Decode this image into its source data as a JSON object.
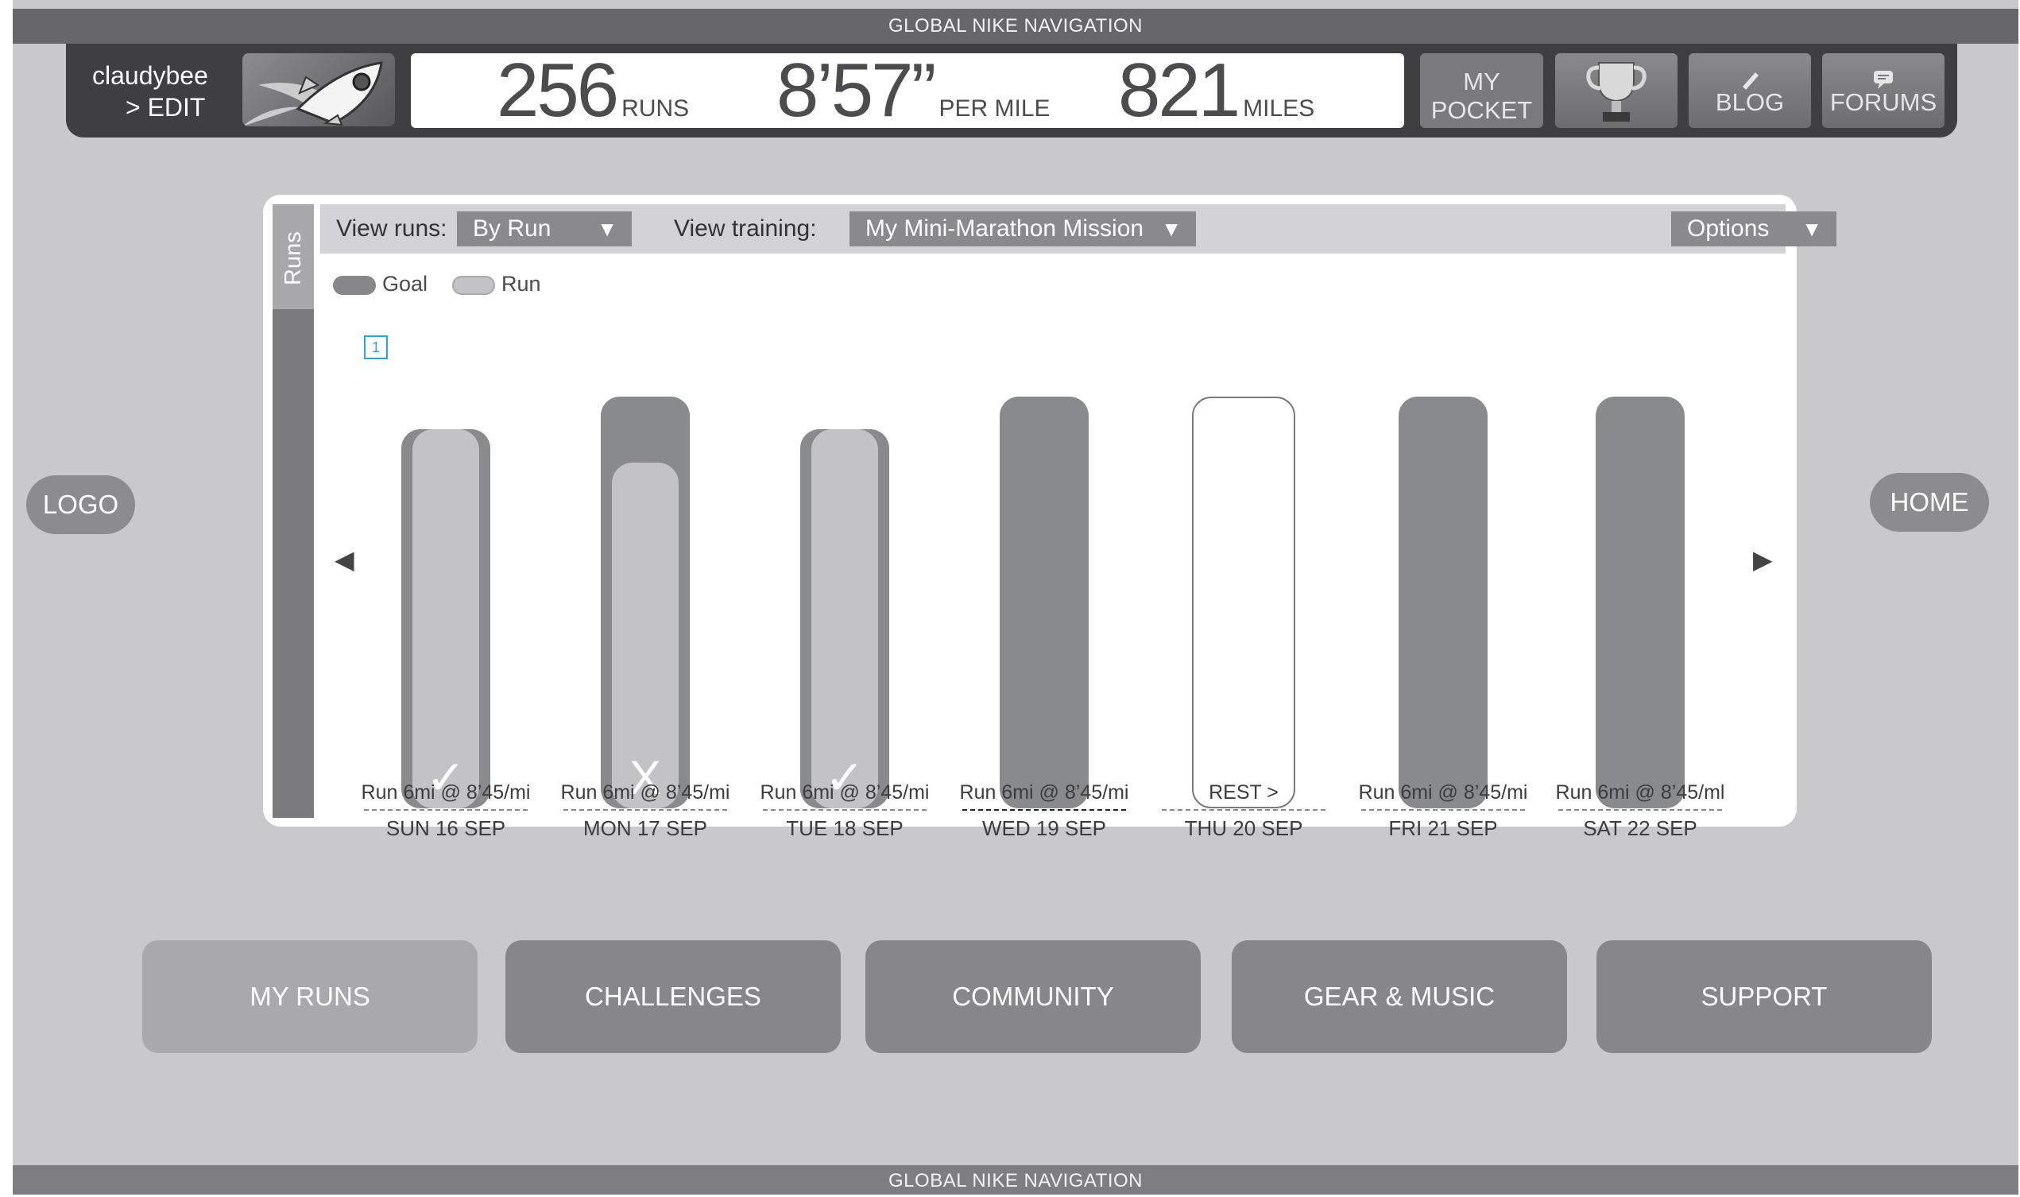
{
  "global_nav": {
    "label": "GLOBAL NIKE NAVIGATION"
  },
  "header": {
    "username": "claudybee",
    "edit_label": "> EDIT",
    "avatar_icon": "rocket-icon",
    "stats": {
      "runs_value": "256",
      "runs_unit": "RUNS",
      "pace_value": "8’57”",
      "pace_unit": "PER MILE",
      "miles_value": "821",
      "miles_unit": "MILES"
    },
    "my_pocket_line1": "MY",
    "my_pocket_line2": "POCKET",
    "trophy_icon": "trophy-icon",
    "blog_label": "BLOG",
    "blog_icon": "pencil-icon",
    "forums_label": "FORUMS",
    "forums_icon": "speech-bubble-icon"
  },
  "side": {
    "logo_label": "LOGO",
    "home_label": "HOME"
  },
  "runs_panel": {
    "tab_label": "Runs",
    "view_runs_label": "View runs:",
    "view_runs_value": "By Run",
    "view_training_label": "View training:",
    "view_training_value": "My Mini-Marathon Mission",
    "options_label": "Options",
    "legend": {
      "goal": "Goal",
      "run": "Run"
    },
    "prev_arrow": "◀",
    "next_arrow": "▶",
    "days": [
      {
        "plan": "Run 6mi @ 8’45/mi",
        "date": "SUN 16 SEP",
        "status": "✓",
        "badge": "1",
        "goal_fraction": 0.92,
        "run_fraction": 0.92
      },
      {
        "plan": "Run 6mi @ 8’45/mi",
        "date": "MON 17 SEP",
        "status": "X",
        "badge": "",
        "goal_fraction": 1.0,
        "run_fraction": 0.84
      },
      {
        "plan": "Run 6mi @ 8’45/mi",
        "date": "TUE 18 SEP",
        "status": "✓",
        "badge": "",
        "goal_fraction": 0.92,
        "run_fraction": 0.92
      },
      {
        "plan": "Run 6mi @ 8’45/mi",
        "date": "WED 19 SEP",
        "status": "",
        "badge": "",
        "goal_fraction": 1.0,
        "run_fraction": 0
      },
      {
        "plan": "REST >",
        "date": "THU 20 SEP",
        "status": "",
        "badge": "",
        "goal_fraction": 1.0,
        "run_fraction": 0,
        "rest": true
      },
      {
        "plan": "Run 6mi @ 8’45/mi",
        "date": "FRI 21 SEP",
        "status": "",
        "badge": "",
        "goal_fraction": 1.0,
        "run_fraction": 0
      },
      {
        "plan": "Run 6mi @ 8’45/ml",
        "date": "SAT 22 SEP",
        "status": "",
        "badge": "",
        "goal_fraction": 1.0,
        "run_fraction": 0
      }
    ]
  },
  "main_nav": {
    "my_runs": "MY RUNS",
    "challenges": "CHALLENGES",
    "community": "COMMUNITY",
    "gear_music": "GEAR & MUSIC",
    "support": "SUPPORT"
  },
  "colors": {
    "background": "#c9c9cb",
    "global_nav": "#67676a",
    "header": "#3f3f41",
    "goal_bar": "#888a8c",
    "run_bar": "#c3c3c5",
    "badge_accent": "#2aa3e0"
  }
}
